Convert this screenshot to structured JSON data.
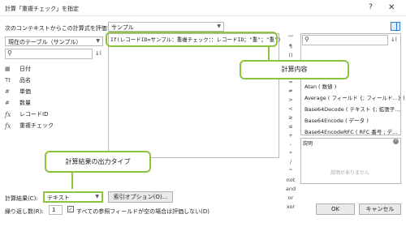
{
  "window": {
    "title": "計算「重複チェック」を指定",
    "help": "?",
    "close": "✕"
  },
  "context": {
    "label": "次のコンテキストからこの計算式を評価する(E):",
    "value": "サンプル"
  },
  "table": {
    "value": "現在のテーブル（サンプル）"
  },
  "left_search": {
    "placeholder": "",
    "icon": "search-icon"
  },
  "fields": [
    {
      "icon": "▦",
      "label": "日付"
    },
    {
      "icon": "Tt",
      "label": "品名"
    },
    {
      "icon": "#",
      "label": "単価"
    },
    {
      "icon": "#",
      "label": "数量"
    },
    {
      "icon": "fx",
      "label": "レコードID"
    },
    {
      "icon": "fx",
      "label": "重複チェック"
    }
  ],
  "formula": {
    "text": "If(レコードID=サンプル：重複チェック：：レコードID；\"重\"；\"重\")"
  },
  "operators": [
    "\"\"",
    "¶",
    "()",
    "",
    "&",
    "=",
    "≠",
    ">",
    "<",
    "≥",
    "≤",
    "+",
    "-",
    "*",
    "/",
    "^",
    "not",
    "and",
    "or",
    "xor"
  ],
  "functions": [
    "Atan ( 数値 )",
    "Average ( フィールド {; フィールド...} )",
    "Base64Decode ( テキスト {; 拡張子...",
    "Base64Encode ( データ )",
    "Base64EncodeRFC ( RFC 番号 ; デ..."
  ],
  "description": {
    "title": "説明",
    "empty": "説明がありません"
  },
  "callouts": {
    "formula": "計算内容",
    "output": "計算結果の出力タイプ"
  },
  "result": {
    "label": "計算結果(C):",
    "value": "テキスト",
    "index_button": "索引オプション(O)..."
  },
  "repeat": {
    "label": "繰り返し数(R):",
    "value": "1",
    "checkbox_checked": true,
    "checkbox_label": "すべての参照フィールドが空の場合は評価しない(D)"
  },
  "buttons": {
    "ok": "OK",
    "cancel": "キャンセル"
  },
  "colors": {
    "highlight": "#8cc43f",
    "accent": "#2a7fd4"
  }
}
